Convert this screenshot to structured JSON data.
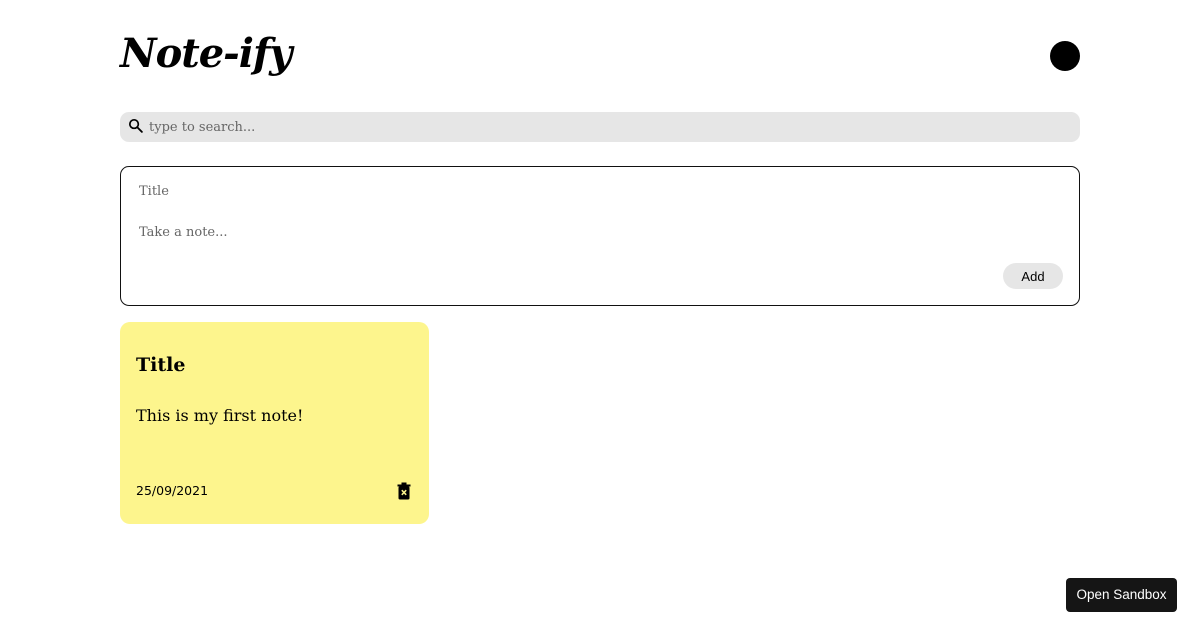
{
  "header": {
    "logo_text": "Note-ify",
    "theme_toggle_icon": "dark-mode-toggle-icon"
  },
  "search": {
    "placeholder": "type to search...",
    "value": "",
    "icon": "search-icon"
  },
  "composer": {
    "title_placeholder": "Title",
    "body_placeholder": "Take a note...",
    "add_label": "Add"
  },
  "notes": [
    {
      "title": "Title",
      "body": "This is my first note!",
      "date": "25/09/2021",
      "color": "#fdf58d",
      "delete_icon": "delete-icon"
    }
  ],
  "sandbox": {
    "label": "Open Sandbox"
  }
}
